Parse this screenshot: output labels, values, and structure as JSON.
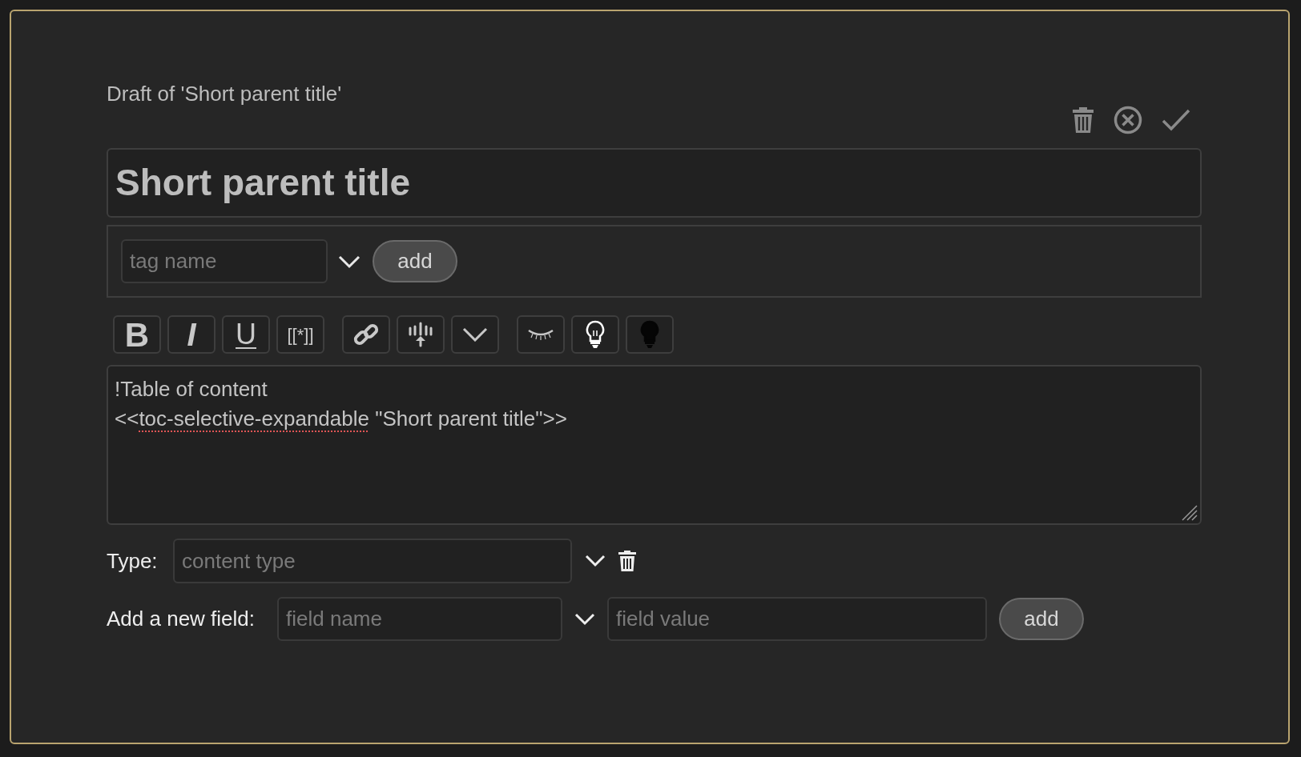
{
  "header": {
    "draft_label": "Draft of 'Short parent title'"
  },
  "title_field": {
    "value": "Short parent title"
  },
  "tags": {
    "placeholder": "tag name",
    "add_button": "add"
  },
  "toolbar": {
    "groups": [
      {
        "buttons": [
          {
            "kind": "text",
            "label": "B"
          },
          {
            "kind": "text",
            "label": "I"
          },
          {
            "kind": "text",
            "label": "U"
          },
          {
            "kind": "text",
            "label": "[[*]]"
          }
        ]
      },
      {
        "buttons": [
          {
            "kind": "icon"
          },
          {
            "kind": "icon"
          },
          {
            "kind": "icon"
          }
        ]
      },
      {
        "buttons": [
          {
            "kind": "icon"
          },
          {
            "kind": "icon"
          },
          {
            "kind": "icon"
          }
        ]
      }
    ]
  },
  "editor": {
    "lines": [
      [
        {
          "text": "!Table of content",
          "misspelled": false
        }
      ],
      [
        {
          "text": "<<",
          "misspelled": false
        },
        {
          "text": "toc-selective-expandable",
          "misspelled": true
        },
        {
          "text": " \"Short parent title\">>",
          "misspelled": false
        }
      ]
    ]
  },
  "type_row": {
    "label": "Type:",
    "placeholder": "content type"
  },
  "field_row": {
    "label": "Add a new field:",
    "name_placeholder": "field name",
    "value_placeholder": "field value",
    "add_button": "add"
  }
}
